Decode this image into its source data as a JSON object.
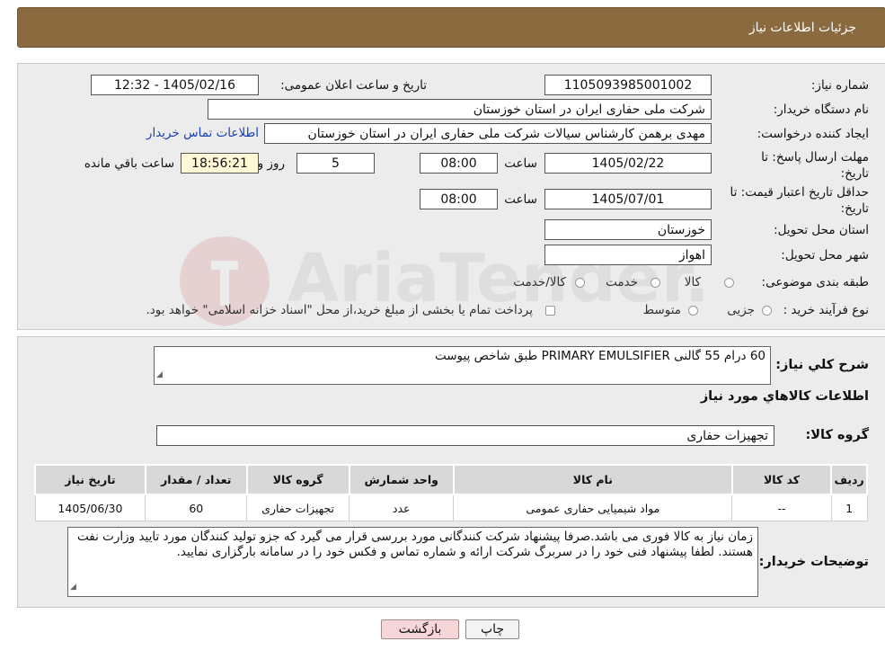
{
  "header": {
    "title": "جزئیات اطلاعات نیاز"
  },
  "form": {
    "need_number_label": "شماره نیاز:",
    "need_number": "1105093985001002",
    "announce_label": "تاریخ و ساعت اعلان عمومی:",
    "announce_value": "1405/02/16 - 12:32",
    "buyer_org_label": "نام دستگاه خریدار:",
    "buyer_org": "شرکت ملی حفاری ایران در استان خوزستان",
    "creator_label": "ایجاد کننده درخواست:",
    "creator": "مهدی برهمن کارشناس سیالات شرکت ملی حفاری ایران در استان خوزستان",
    "contact_link": "اطلاعات تماس خریدار",
    "deadline_label": "مهلت ارسال پاسخ: تا تاریخ:",
    "deadline_date": "1405/02/22",
    "time_label": "ساعت",
    "deadline_time": "08:00",
    "days": "5",
    "days_label": "روز و",
    "remaining": "18:56:21",
    "remaining_label": "ساعت باقي مانده",
    "min_valid_label": "حداقل تاریخ اعتبار قیمت: تا تاریخ:",
    "min_valid_date": "1405/07/01",
    "min_valid_time": "08:00",
    "province_label": "استان محل تحویل:",
    "province": "خوزستان",
    "city_label": "شهر محل تحویل:",
    "city": "اهواز",
    "category_label": "طبقه بندی موضوعی:",
    "category_options": [
      "کالا",
      "خدمت",
      "کالا/خدمت"
    ],
    "process_label": "نوع فرآیند خرید :",
    "process_options": [
      "جزیی",
      "متوسط"
    ],
    "process_note": "پرداخت تمام یا بخشی از مبلغ خرید،از محل \"اسناد خزانه اسلامی\" خواهد بود."
  },
  "summary": {
    "desc_label": "شرح کلي نیاز:",
    "desc": "60 درام 55 گالنی PRIMARY EMULSIFIER طبق شاخص پیوست",
    "goods_info_title": "اطلاعات کالاهاي مورد نیاز",
    "group_label": "گروه کالا:",
    "group_value": "تجهیزات حفاری"
  },
  "table": {
    "headers": [
      "ردیف",
      "کد کالا",
      "نام کالا",
      "واحد شمارش",
      "گروه کالا",
      "تعداد / مقدار",
      "تاریخ نیاز"
    ],
    "rows": [
      [
        "1",
        "--",
        "مواد شیمیایی حفاری عمومی",
        "عدد",
        "تجهیزات حفاری",
        "60",
        "1405/06/30"
      ]
    ]
  },
  "notes": {
    "label": "توضیحات خریدار:",
    "text": "زمان نیاز به کالا فوری می باشد.صرفا پیشنهاد شرکت کنندگانی مورد بررسی قرار می گیرد که جزو تولید کنندگان  مورد تایید وزارت نفت هستند. لطفا پیشنهاد فنی خود را در سربرگ شرکت ارائه و شماره تماس و فکس خود را در سامانه بارگزاری نمایید."
  },
  "buttons": {
    "print": "چاپ",
    "back": "بازگشت"
  },
  "colors": {
    "header_bg": "#8a6a3e",
    "link": "#1a3fb5",
    "back_btn_bg": "#f6d6d6"
  }
}
